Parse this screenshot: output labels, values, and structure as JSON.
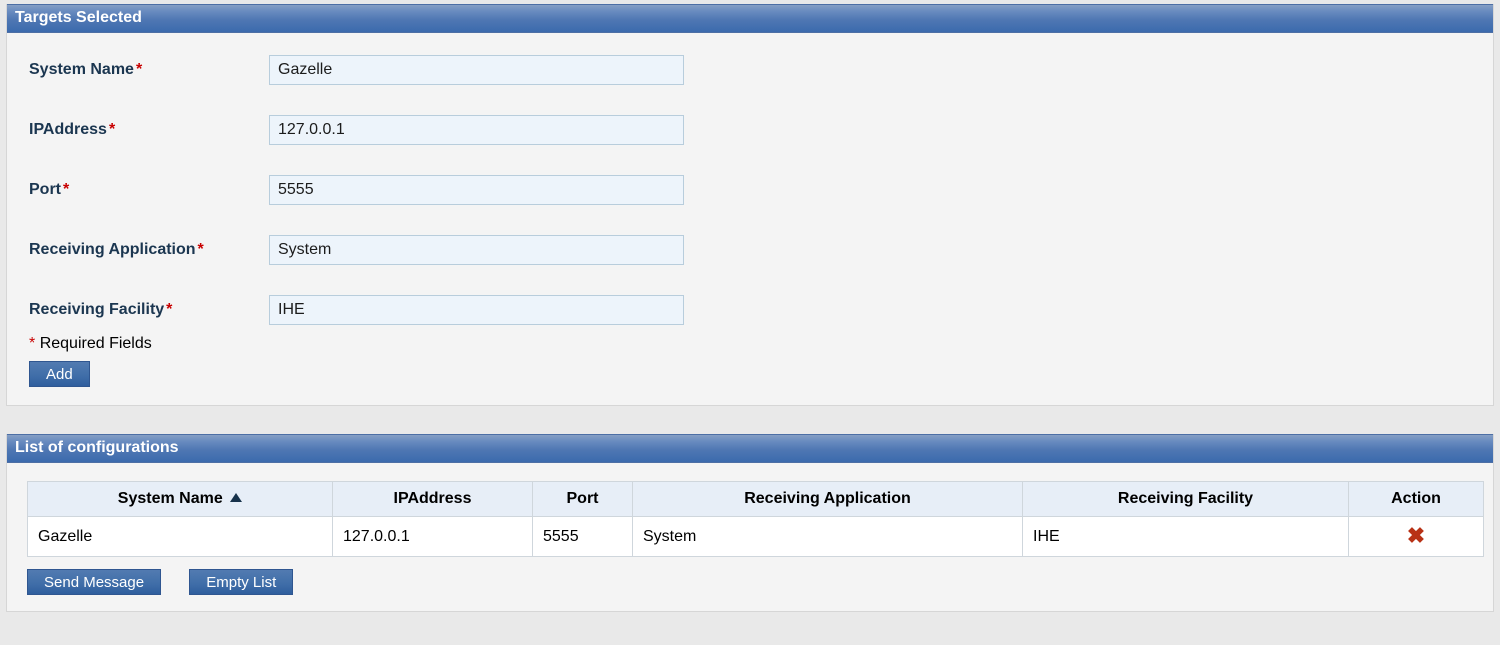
{
  "targets_panel": {
    "title": "Targets Selected",
    "fields": {
      "system_name": {
        "label": "System Name",
        "value": "Gazelle",
        "required": true
      },
      "ip_address": {
        "label": "IPAddress",
        "value": "127.0.0.1",
        "required": true
      },
      "port": {
        "label": "Port",
        "value": "5555",
        "required": true
      },
      "recv_app": {
        "label": "Receiving Application",
        "value": "System",
        "required": true
      },
      "recv_fac": {
        "label": "Receiving Facility",
        "value": "IHE",
        "required": true
      }
    },
    "required_note": "Required Fields",
    "add_button": "Add"
  },
  "list_panel": {
    "title": "List of configurations",
    "columns": {
      "system_name": "System Name",
      "ip_address": "IPAddress",
      "port": "Port",
      "recv_app": "Receiving Application",
      "recv_fac": "Receiving Facility",
      "action": "Action"
    },
    "rows": [
      {
        "system_name": "Gazelle",
        "ip_address": "127.0.0.1",
        "port": "5555",
        "recv_app": "System",
        "recv_fac": "IHE"
      }
    ],
    "send_button": "Send Message",
    "empty_button": "Empty List"
  }
}
